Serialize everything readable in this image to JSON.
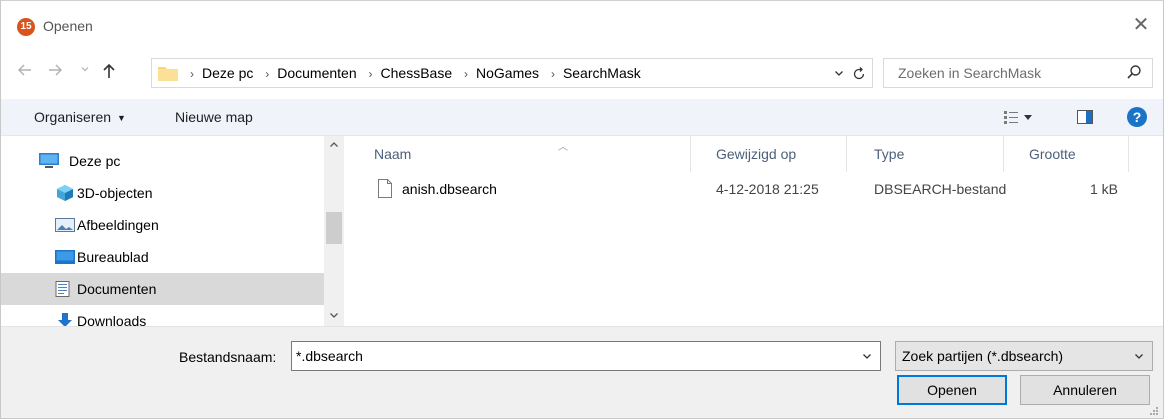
{
  "window": {
    "title": "Openen",
    "app_icon_text": "15",
    "close_label": "✕"
  },
  "nav": {
    "back_icon": "arrow-left-icon",
    "forward_icon": "arrow-right-icon",
    "up_icon": "arrow-up-icon",
    "breadcrumbs": [
      "Deze pc",
      "Documenten",
      "ChessBase",
      "NoGames",
      "SearchMask"
    ],
    "search_placeholder": "Zoeken in SearchMask"
  },
  "toolbar": {
    "organize_label": "Organiseren",
    "new_folder_label": "Nieuwe map",
    "help_label": "?"
  },
  "tree": {
    "items": [
      {
        "label": "Deze pc",
        "icon": "computer-icon"
      },
      {
        "label": "3D-objecten",
        "icon": "cube-icon"
      },
      {
        "label": "Afbeeldingen",
        "icon": "pictures-icon"
      },
      {
        "label": "Bureaublad",
        "icon": "desktop-icon"
      },
      {
        "label": "Documenten",
        "icon": "documents-icon",
        "selected": true
      },
      {
        "label": "Downloads",
        "icon": "download-icon"
      }
    ]
  },
  "filelist": {
    "columns": [
      "Naam",
      "Gewijzigd op",
      "Type",
      "Grootte"
    ],
    "rows": [
      {
        "name": "anish.dbsearch",
        "modified": "4-12-2018 21:25",
        "type": "DBSEARCH-bestand",
        "size": "1 kB"
      }
    ]
  },
  "footer": {
    "filename_label": "Bestandsnaam:",
    "filename_value": "*.dbsearch",
    "filter_value": "Zoek partijen (*.dbsearch)",
    "open_label": "Openen",
    "cancel_label": "Annuleren"
  },
  "colors": {
    "accent": "#0078d7",
    "toolbar_bg": "#f0f3f9",
    "selected_bg": "#d9d9d9",
    "folder_yellow": "#f8d775"
  }
}
